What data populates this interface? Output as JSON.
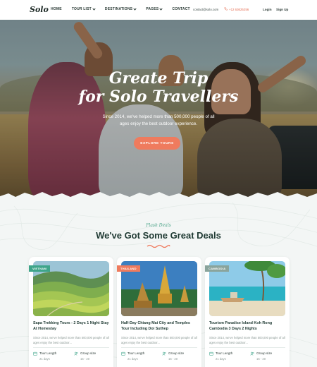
{
  "nav": {
    "logo": "Solo",
    "menu": [
      {
        "label": "HOME",
        "dropdown": false
      },
      {
        "label": "TOUR LIST",
        "dropdown": true
      },
      {
        "label": "DESTINATIONS",
        "dropdown": true
      },
      {
        "label": "PAGES",
        "dropdown": true
      },
      {
        "label": "CONTACT",
        "dropdown": false
      }
    ],
    "email": "contact@solo.com",
    "phone": "+12 63625256",
    "login": "Login",
    "signup": "Sign Up"
  },
  "hero": {
    "title_line1": "Greate Trip",
    "title_line2": "for Solo Travellers",
    "subtitle_line1": "Since 2014, we've helped more than 500,000 people of all",
    "subtitle_line2": "ages enjoy the best outdoor experience.",
    "cta": "EXPLORE TOURS"
  },
  "deals": {
    "kicker": "Flash Deals",
    "title": "We've Got Some Great Deals",
    "cards": [
      {
        "tag": "VIETNAM",
        "title": "Sapa Trekking Tours - 2 Days 1 Night Stay At Homestay",
        "desc": "Since 2014, we've helped more than 500,000 people of all ages enjoy the best outdoor...",
        "tour_length_label": "Tour Length",
        "tour_length": "21 days",
        "group_label": "Group size",
        "group_size": "15 - 20"
      },
      {
        "tag": "THAILAND",
        "title": "Half-Day Chiang Mai City and Temples Tour Including Doi Suthep",
        "desc": "Since 2014, we've helped more than 500,000 people of all ages enjoy the best outdoor...",
        "tour_length_label": "Tour Length",
        "tour_length": "21 days",
        "group_label": "Group size",
        "group_size": "15 - 20"
      },
      {
        "tag": "CAMBODIA",
        "title": "Tourism Paradise Island Koh Rong Cambodia 3 Days 2 Nights",
        "desc": "Since 2014, we've helped more than 500,000 people of all ages enjoy the best outdoor...",
        "tour_length_label": "Tour Length",
        "tour_length": "21 days",
        "group_label": "Group size",
        "group_size": "15 - 20"
      }
    ]
  },
  "colors": {
    "accent": "#ef7b5e",
    "green": "#3fa58a",
    "dark": "#1f3a33"
  }
}
